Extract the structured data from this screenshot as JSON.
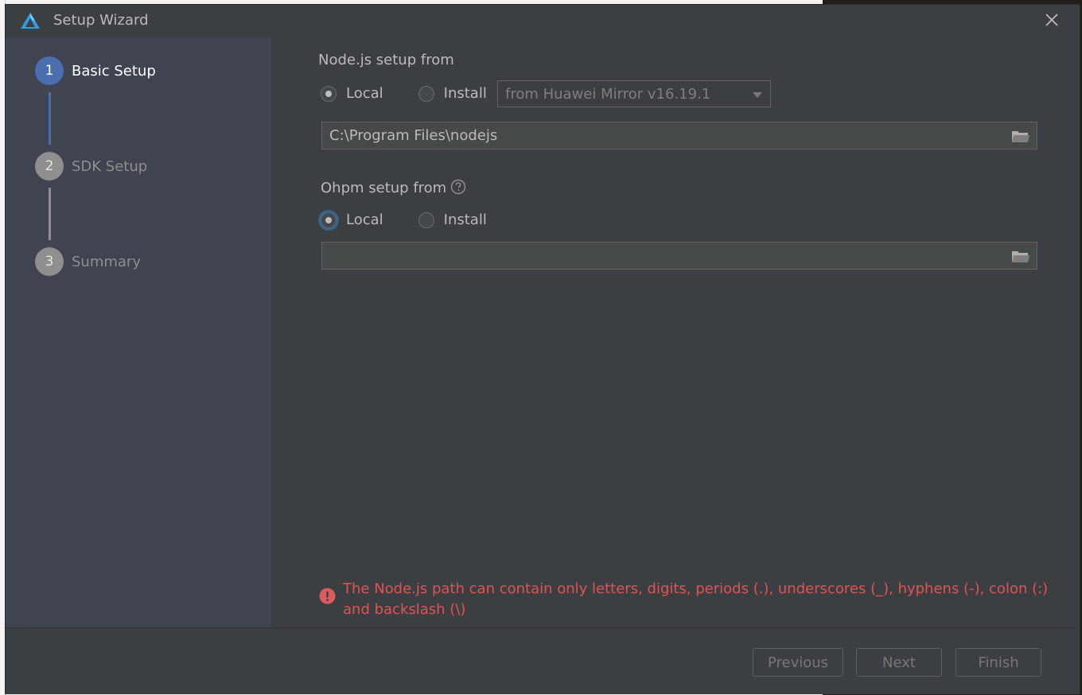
{
  "window": {
    "title": "Setup Wizard"
  },
  "steps": [
    {
      "number": "1",
      "label": "Basic Setup",
      "active": true
    },
    {
      "number": "2",
      "label": "SDK Setup",
      "active": false
    },
    {
      "number": "3",
      "label": "Summary",
      "active": false
    }
  ],
  "node": {
    "section_label": "Node.js setup from",
    "radio_local": "Local",
    "radio_install": "Install",
    "selected": "Local",
    "mirror_select": "from Huawei Mirror v16.19.1",
    "path_value": "C:\\Program Files\\nodejs"
  },
  "ohpm": {
    "section_label": "Ohpm setup from",
    "radio_local": "Local",
    "radio_install": "Install",
    "selected": "Local",
    "path_value": ""
  },
  "error": {
    "message": "The Node.js path can contain only letters, digits, periods (.), underscores (_), hyphens (-), colon (:) and backslash (\\)"
  },
  "buttons": {
    "previous": "Previous",
    "next": "Next",
    "finish": "Finish"
  },
  "colors": {
    "accent": "#4b6eaf",
    "error": "#e35252",
    "dialog_bg": "#3c3f41",
    "sidebar_bg": "#3f4450"
  },
  "icons": {
    "app": "app-logo-icon",
    "close": "close-icon",
    "folder": "folder-icon",
    "help": "help-icon",
    "error": "error-icon"
  }
}
